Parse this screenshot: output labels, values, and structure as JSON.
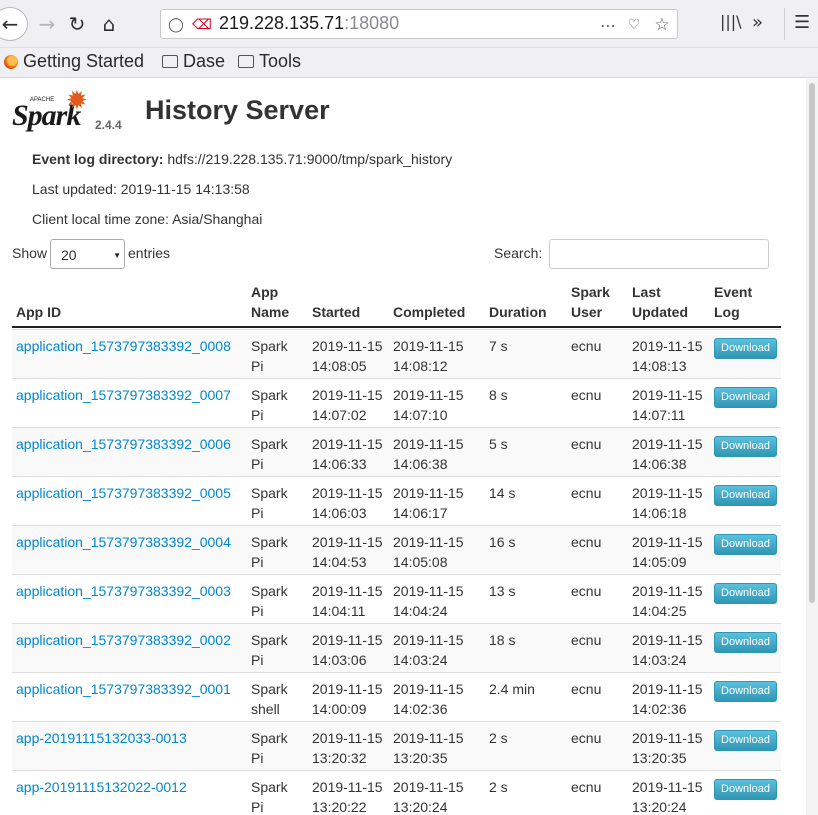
{
  "browser": {
    "url_host": "219.228.135.71",
    "url_port": ":18080",
    "bookmarks": [
      "Getting Started",
      "Dase",
      "Tools"
    ]
  },
  "header": {
    "logo_word": "Spark",
    "logo_apache": "APACHE",
    "version": "2.4.4",
    "title": "History Server"
  },
  "meta": {
    "event_log_label": "Event log directory:",
    "event_log_value": "hdfs://219.228.135.71:9000/tmp/spark_history",
    "last_updated": "Last updated: 2019-11-15 14:13:58",
    "timezone": "Client local time zone: Asia/Shanghai"
  },
  "controls": {
    "show_label": "Show",
    "show_value": "20",
    "entries_label": "entries",
    "search_label": "Search:",
    "search_value": ""
  },
  "table": {
    "headers": {
      "app_id": "App ID",
      "app_name_1": "App",
      "app_name_2": "Name",
      "started": "Started",
      "completed": "Completed",
      "duration": "Duration",
      "user_1": "Spark",
      "user_2": "User",
      "last_1": "Last",
      "last_2": "Updated",
      "event_1": "Event",
      "event_2": "Log"
    },
    "download_label": "Download",
    "rows": [
      {
        "id": "application_1573797383392_0008",
        "name1": "Spark",
        "name2": "Pi",
        "s1": "2019-11-15",
        "s2": "14:08:05",
        "c1": "2019-11-15",
        "c2": "14:08:12",
        "duration": "7 s",
        "user": "ecnu",
        "u1": "2019-11-15",
        "u2": "14:08:13"
      },
      {
        "id": "application_1573797383392_0007",
        "name1": "Spark",
        "name2": "Pi",
        "s1": "2019-11-15",
        "s2": "14:07:02",
        "c1": "2019-11-15",
        "c2": "14:07:10",
        "duration": "8 s",
        "user": "ecnu",
        "u1": "2019-11-15",
        "u2": "14:07:11"
      },
      {
        "id": "application_1573797383392_0006",
        "name1": "Spark",
        "name2": "Pi",
        "s1": "2019-11-15",
        "s2": "14:06:33",
        "c1": "2019-11-15",
        "c2": "14:06:38",
        "duration": "5 s",
        "user": "ecnu",
        "u1": "2019-11-15",
        "u2": "14:06:38"
      },
      {
        "id": "application_1573797383392_0005",
        "name1": "Spark",
        "name2": "Pi",
        "s1": "2019-11-15",
        "s2": "14:06:03",
        "c1": "2019-11-15",
        "c2": "14:06:17",
        "duration": "14 s",
        "user": "ecnu",
        "u1": "2019-11-15",
        "u2": "14:06:18"
      },
      {
        "id": "application_1573797383392_0004",
        "name1": "Spark",
        "name2": "Pi",
        "s1": "2019-11-15",
        "s2": "14:04:53",
        "c1": "2019-11-15",
        "c2": "14:05:08",
        "duration": "16 s",
        "user": "ecnu",
        "u1": "2019-11-15",
        "u2": "14:05:09"
      },
      {
        "id": "application_1573797383392_0003",
        "name1": "Spark",
        "name2": "Pi",
        "s1": "2019-11-15",
        "s2": "14:04:11",
        "c1": "2019-11-15",
        "c2": "14:04:24",
        "duration": "13 s",
        "user": "ecnu",
        "u1": "2019-11-15",
        "u2": "14:04:25"
      },
      {
        "id": "application_1573797383392_0002",
        "name1": "Spark",
        "name2": "Pi",
        "s1": "2019-11-15",
        "s2": "14:03:06",
        "c1": "2019-11-15",
        "c2": "14:03:24",
        "duration": "18 s",
        "user": "ecnu",
        "u1": "2019-11-15",
        "u2": "14:03:24"
      },
      {
        "id": "application_1573797383392_0001",
        "name1": "Spark",
        "name2": "shell",
        "s1": "2019-11-15",
        "s2": "14:00:09",
        "c1": "2019-11-15",
        "c2": "14:02:36",
        "duration": "2.4 min",
        "user": "ecnu",
        "u1": "2019-11-15",
        "u2": "14:02:36"
      },
      {
        "id": "app-20191115132033-0013",
        "name1": "Spark",
        "name2": "Pi",
        "s1": "2019-11-15",
        "s2": "13:20:32",
        "c1": "2019-11-15",
        "c2": "13:20:35",
        "duration": "2 s",
        "user": "ecnu",
        "u1": "2019-11-15",
        "u2": "13:20:35"
      },
      {
        "id": "app-20191115132022-0012",
        "name1": "Spark",
        "name2": "Pi",
        "s1": "2019-11-15",
        "s2": "13:20:22",
        "c1": "2019-11-15",
        "c2": "13:20:24",
        "duration": "2 s",
        "user": "ecnu",
        "u1": "2019-11-15",
        "u2": "13:20:24"
      }
    ]
  }
}
